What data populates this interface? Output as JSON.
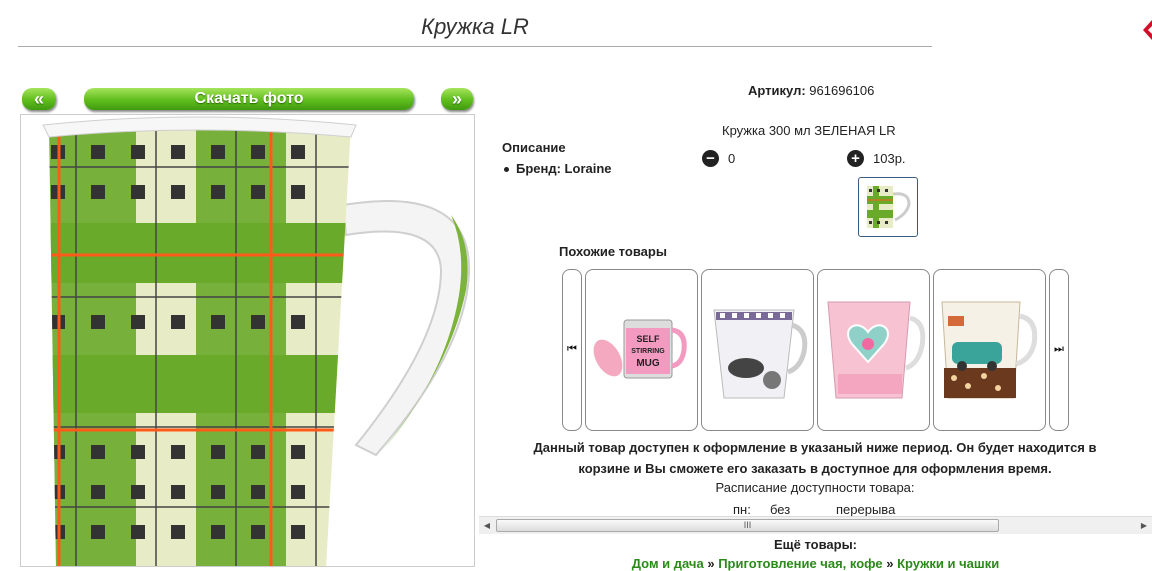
{
  "product": {
    "title": "Кружка LR",
    "sku_label": "Артикул:",
    "sku_value": "961696106",
    "description_title": "Описание",
    "brand_line": "Бренд: Loraine",
    "variant_name": "Кружка 300 мл ЗЕЛЕНАЯ LR",
    "quantity": "0",
    "price": "103р.",
    "minus_glyph": "−",
    "plus_glyph": "+"
  },
  "photo_nav": {
    "prev_label": "«",
    "download_label": "Скачать фото",
    "next_label": "»"
  },
  "similar": {
    "title": "Похожие товары",
    "prev_glyph": "⏮",
    "next_glyph": "⏭",
    "items": [
      {
        "name": "self-stirring-mug",
        "text1": "SELF",
        "text2": "STIRRING",
        "text3": "MUG"
      },
      {
        "name": "fashion-mug"
      },
      {
        "name": "heart-mug"
      },
      {
        "name": "car-mug"
      }
    ]
  },
  "availability": {
    "notice_line1": "Данный товар доступен к оформление в указаный ниже период. Он будет находится в",
    "notice_line2": "корзине и Вы сможете его заказать в доступное для оформления время.",
    "schedule_title": "Расписание доступности товара:",
    "day": "пн:",
    "no_label": "без",
    "break_label": "перерыва"
  },
  "scrollbar": {
    "left_arrow": "◀",
    "right_arrow": "▶",
    "grip": "III"
  },
  "more": {
    "title": "Ещё товары:",
    "crumb1": "Дом и дача",
    "sep": "»",
    "crumb2": "Приготовление чая, кофе",
    "crumb3": "Кружки и чашки"
  },
  "colors": {
    "button_green": "#5fbd1d",
    "link_green": "#2b8a1a",
    "plaid_green": "#6aaa2a",
    "plaid_orange": "#ff5a1a"
  },
  "icons": [
    "minus-circle-icon",
    "plus-circle-icon",
    "first-page-icon",
    "last-page-icon"
  ]
}
